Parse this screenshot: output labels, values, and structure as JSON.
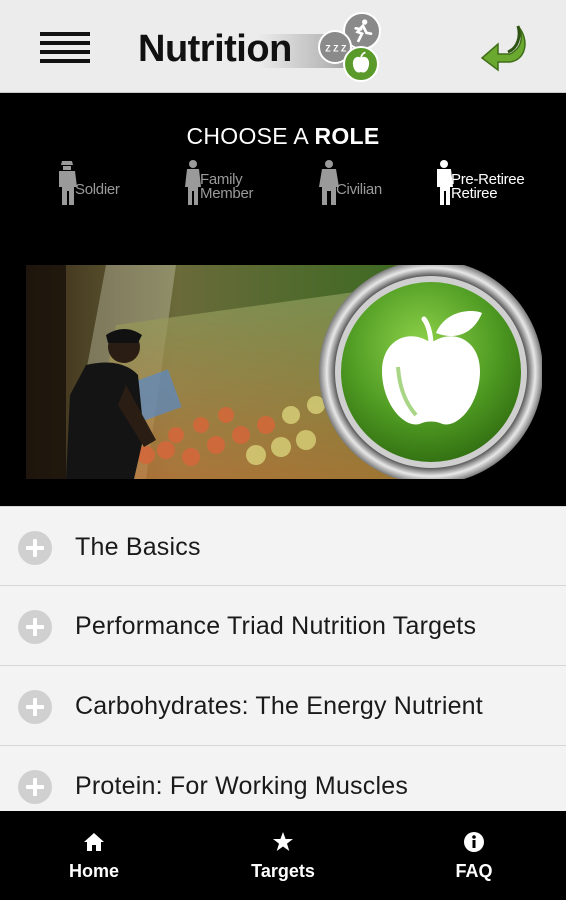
{
  "header": {
    "menu_icon": "hamburger-menu-icon",
    "logo_text": "Nutrition",
    "logo_badge_sleep": "Z Z Z",
    "back_icon": "back-arrow-icon",
    "colors": {
      "background": "#ececec",
      "back_arrow": "#6aa830",
      "apple_green": "#5a9a2a"
    }
  },
  "roles": {
    "title_prefix": "CHOOSE A ",
    "title_bold": "ROLE",
    "items": [
      {
        "label_line1": "Soldier",
        "label_line2": "",
        "icon": "soldier-icon",
        "active": false
      },
      {
        "label_line1": "Family",
        "label_line2": "Member",
        "icon": "family-member-icon",
        "active": false
      },
      {
        "label_line1": "Civilian",
        "label_line2": "",
        "icon": "civilian-icon",
        "active": false
      },
      {
        "label_line1": "Pre-Retiree",
        "label_line2": "Retiree",
        "icon": "retiree-icon",
        "active": true
      }
    ]
  },
  "hero": {
    "photo": "grocery-produce-photo",
    "badge_icon": "apple-icon"
  },
  "topics": [
    {
      "label": "The Basics"
    },
    {
      "label": "Performance Triad Nutrition Targets"
    },
    {
      "label": "Carbohydrates: The Energy Nutrient"
    },
    {
      "label": "Protein: For Working Muscles"
    }
  ],
  "nav": {
    "home": {
      "label": "Home",
      "icon": "home-icon"
    },
    "targets": {
      "label": "Targets",
      "icon": "star-icon"
    },
    "faq": {
      "label": "FAQ",
      "icon": "info-icon"
    }
  }
}
